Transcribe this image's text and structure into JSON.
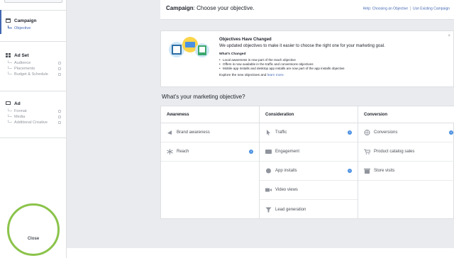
{
  "sidebar": {
    "campaign": {
      "label": "Campaign",
      "items": [
        "Objective"
      ]
    },
    "adset": {
      "label": "Ad Set",
      "items": [
        "Audience",
        "Placements",
        "Budget & Schedule"
      ]
    },
    "ad": {
      "label": "Ad",
      "items": [
        "Format",
        "Media",
        "Additional Creative"
      ]
    },
    "close_label": "Close"
  },
  "header": {
    "title_bold": "Campaign",
    "title_rest": ": Choose your objective.",
    "link_help": "Help: Choosing an Objective",
    "link_existing": "Use Existing Campaign"
  },
  "notice": {
    "title": "Objectives Have Changed",
    "body": "We updated objectives to make it easier to choose the right one for your marketing goal.",
    "whats_changed": "What's Changed",
    "bullets": [
      "Local awareness is now part of the reach objective",
      "Offers is now available in the traffic and conversions objectives",
      "Mobile app installs and desktop app installs are now part of the app installs objective"
    ],
    "explore_prefix": "Explore the new objectives and",
    "explore_link": "learn more.",
    "close_glyph": "×"
  },
  "question": "What's your marketing objective?",
  "columns": [
    {
      "header": "Awareness",
      "items": [
        "Brand awareness",
        "Reach"
      ]
    },
    {
      "header": "Consideration",
      "items": [
        "Traffic",
        "Engagement",
        "App installs",
        "Video views",
        "Lead generation"
      ]
    },
    {
      "header": "Conversion",
      "items": [
        "Conversions",
        "Product catalog sales",
        "Store visits"
      ]
    }
  ],
  "icons": {
    "info_glyph": "i"
  },
  "colors": {
    "accent": "#4267b2",
    "highlight_circle": "#8bc34a",
    "info": "#4a90e2"
  }
}
